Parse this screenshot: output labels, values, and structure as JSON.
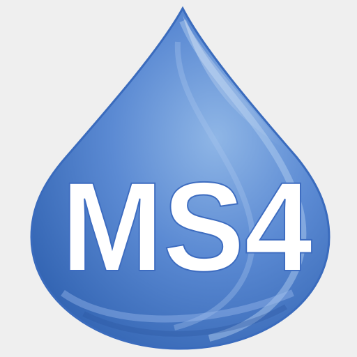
{
  "logo": {
    "text": "MS4",
    "shape": "water-drop-icon",
    "colors": {
      "background": "#efefef",
      "drop_light": "#8fb6e6",
      "drop_mid": "#4f80cc",
      "drop_dark": "#2d5fae",
      "drop_edge": "#3a6bbd",
      "text": "#ffffff"
    }
  }
}
